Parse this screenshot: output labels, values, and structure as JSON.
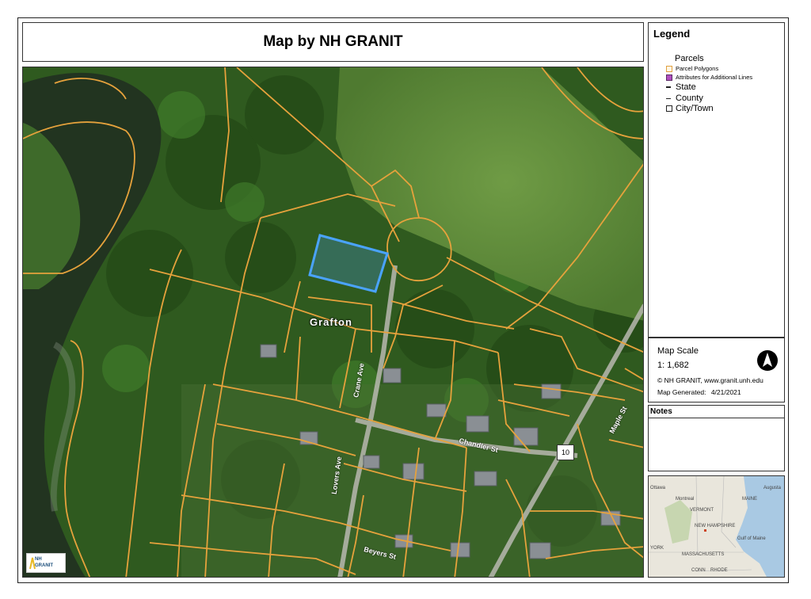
{
  "title": "Map by NH GRANIT",
  "legend": {
    "heading": "Legend",
    "group_label": "Parcels",
    "items": [
      {
        "label": "Parcel Polygons",
        "icon": "parcel-polygon-swatch",
        "color": "#e0a040"
      },
      {
        "label": "Attributes for Additional Lines",
        "icon": "attribute-line-swatch",
        "color": "#b04fbf"
      },
      {
        "label": "State",
        "icon": "state-line-swatch"
      },
      {
        "label": "County",
        "icon": "county-line-swatch"
      },
      {
        "label": "City/Town",
        "icon": "city-town-swatch"
      }
    ]
  },
  "scale": {
    "label": "Map Scale",
    "value": "1: 1,682",
    "credit": "© NH GRANIT, www.granit.unh.edu",
    "generated_label": "Map Generated:",
    "generated_date": "4/21/2021"
  },
  "notes": {
    "header": "Notes"
  },
  "map": {
    "town_label": "Grafton",
    "route_shield": "10",
    "street_labels": [
      "Maple St",
      "Chandler St",
      "Crane Ave",
      "Lovers Ave",
      "Beyers St"
    ],
    "colors": {
      "parcel": "#e6a23c",
      "selected": "#4aa3ff",
      "forest": "#2f5a1f",
      "river": "#2a3d22",
      "field": "#5f8f3a"
    }
  },
  "overview_map": {
    "labels": [
      "Montreal",
      "VERMONT",
      "MAINE",
      "NEW HAMPSHIRE",
      "Gulf of Maine",
      "MASSACHUSETTS",
      "CONN",
      "RHODE",
      "Augusta",
      "Ottawa",
      "YORK"
    ]
  },
  "logo": {
    "line1": "NH",
    "line2": "GRANIT"
  }
}
